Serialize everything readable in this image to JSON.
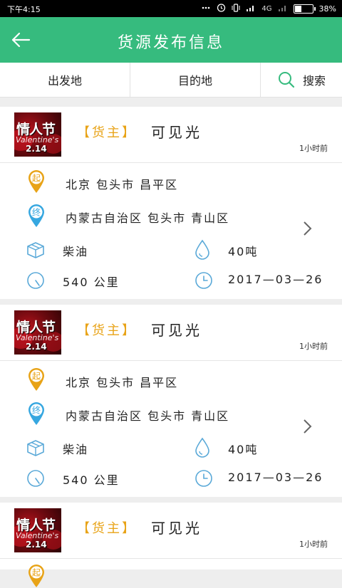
{
  "status": {
    "time": "下午4:15",
    "network": "4G",
    "battery": "38%",
    "battery_level": 0.38
  },
  "header": {
    "title": "货源发布信息"
  },
  "filters": {
    "origin": "出发地",
    "destination": "目的地",
    "search": "搜索"
  },
  "colors": {
    "primary": "#36bb7e",
    "tag": "#e8a317",
    "icon_blue": "#5aa9d8",
    "pin_orange": "#e8a317",
    "pin_blue": "#36a7e0"
  },
  "cards": [
    {
      "thumb_title": "情人节",
      "thumb_sub": "Valentine's Day",
      "thumb_date": "2.14",
      "tag": "【货主】",
      "owner": "可见光",
      "time_ago": "1小时前",
      "from_badge": "起",
      "from": "北京  包头市  昌平区",
      "to_badge": "终",
      "to": "内蒙古自治区  包头市  青山区",
      "cargo": "柴油",
      "weight": "40吨",
      "distance": "540 公里",
      "date": "2017—03—26"
    },
    {
      "thumb_title": "情人节",
      "thumb_sub": "Valentine's Day",
      "thumb_date": "2.14",
      "tag": "【货主】",
      "owner": "可见光",
      "time_ago": "1小时前",
      "from_badge": "起",
      "from": "北京  包头市  昌平区",
      "to_badge": "终",
      "to": "内蒙古自治区  包头市  青山区",
      "cargo": "柴油",
      "weight": "40吨",
      "distance": "540 公里",
      "date": "2017—03—26"
    },
    {
      "thumb_title": "情人节",
      "thumb_sub": "Valentine's Day",
      "thumb_date": "2.14",
      "tag": "【货主】",
      "owner": "可见光",
      "time_ago": "1小时前",
      "from_badge": "起"
    }
  ]
}
